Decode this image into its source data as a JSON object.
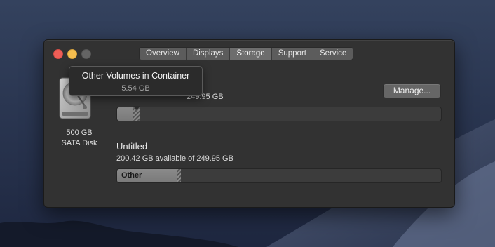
{
  "tabs": [
    {
      "label": "Overview",
      "selected": false
    },
    {
      "label": "Displays",
      "selected": false
    },
    {
      "label": "Storage",
      "selected": true
    },
    {
      "label": "Support",
      "selected": false
    },
    {
      "label": "Service",
      "selected": false
    }
  ],
  "disk": {
    "icon": "hard-disk-icon",
    "capacity": "500 GB",
    "type": "SATA Disk"
  },
  "volume1": {
    "available_text": "249.95 GB",
    "segments": [
      {
        "label": "",
        "fraction": 0.048,
        "pattern": "solid"
      },
      {
        "label": "",
        "fraction": 0.022,
        "pattern": "hatched"
      }
    ]
  },
  "manage_button": {
    "label": "Manage..."
  },
  "volume2": {
    "name": "Untitled",
    "available_text": "200.42 GB available of 249.95 GB",
    "segments": [
      {
        "label": "Other",
        "fraction": 0.185,
        "pattern": "solid"
      },
      {
        "label": "",
        "fraction": 0.012,
        "pattern": "hatched"
      }
    ]
  },
  "tooltip": {
    "title": "Other Volumes in Container",
    "size": "5.54 GB"
  },
  "colors": {
    "close": "#ee5e57",
    "minimize": "#f5be4f",
    "zoom": "#646464",
    "window_bg": "#323232",
    "bar_fill": "#8a8a8a"
  }
}
